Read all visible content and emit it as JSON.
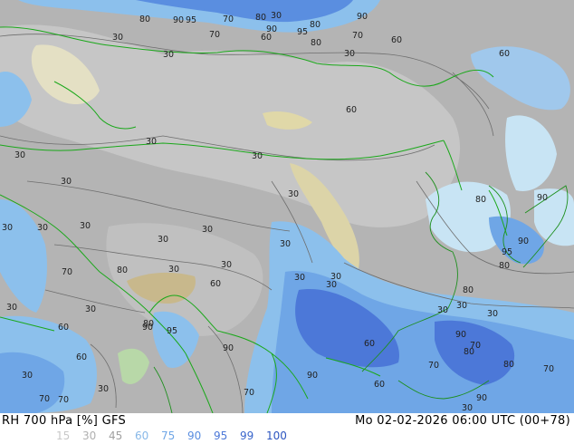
{
  "header": {
    "title": "RH 700 hPa [%] GFS",
    "valid_time": "Mo 02-02-2026 06:00 UTC (00+78)"
  },
  "legend": {
    "items": [
      {
        "value": "15",
        "color": "#c8c8c8"
      },
      {
        "value": "30",
        "color": "#b0b0b0"
      },
      {
        "value": "45",
        "color": "#a0a0a0"
      },
      {
        "value": "60",
        "color": "#88b8e8"
      },
      {
        "value": "75",
        "color": "#6fa6e6"
      },
      {
        "value": "90",
        "color": "#5a8ee0"
      },
      {
        "value": "95",
        "color": "#4c78d8"
      },
      {
        "value": "99",
        "color": "#3a66cc"
      },
      {
        "value": "100",
        "color": "#2c55c0"
      }
    ]
  },
  "contour_labels": [
    "80",
    "90",
    "95",
    "70",
    "80",
    "30",
    "80",
    "90",
    "30",
    "70",
    "60",
    "90",
    "95",
    "60",
    "80",
    "70",
    "60",
    "30",
    "30",
    "60",
    "30",
    "30",
    "30",
    "30",
    "30",
    "30",
    "30",
    "30",
    "30",
    "80",
    "60",
    "30",
    "30",
    "70",
    "30",
    "30",
    "30",
    "30",
    "30",
    "30",
    "80",
    "90",
    "95",
    "60",
    "90",
    "30",
    "60",
    "30",
    "70",
    "90",
    "60",
    "80",
    "30",
    "30",
    "30",
    "80",
    "90",
    "90",
    "95",
    "80",
    "90",
    "80",
    "70",
    "70",
    "80",
    "70",
    "60",
    "70",
    "30",
    "90",
    "30",
    "70"
  ],
  "colors": {
    "dry_gray": "#a8a8a8",
    "light_gray": "#c8c8c8",
    "terrain_light": "#e8e8d8",
    "terrain_tan": "#d8d0a8",
    "terrain_green": "#b8d8a8",
    "sea_light": "#c8e4f4",
    "moist_blue_1": "#8cc0ec",
    "moist_blue_2": "#5a8ee0",
    "moist_blue_3": "#3a66cc",
    "border_green": "#1aa81a",
    "contour": "#6e6e6e"
  }
}
